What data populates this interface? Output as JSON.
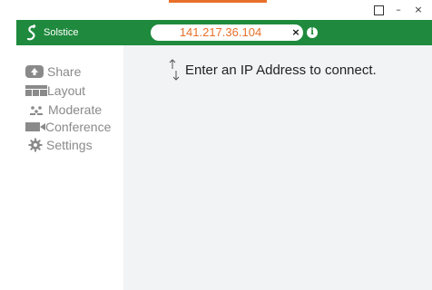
{
  "window": {
    "maximize_glyph": "",
    "minimize_glyph": "–",
    "close_glyph": "×"
  },
  "header": {
    "brand_name": "Solstice",
    "brand_icon": "solstice-logo-icon",
    "ip_value": "141.217.36.104",
    "clear_glyph": "×",
    "info_glyph": "i"
  },
  "sidebar": {
    "items": [
      {
        "label": "Share",
        "icon": "share-icon"
      },
      {
        "label": "Layout",
        "icon": "layout-icon"
      },
      {
        "label": "Moderate",
        "icon": "moderate-icon"
      },
      {
        "label": "Conference",
        "icon": "conference-icon"
      },
      {
        "label": "Settings",
        "icon": "gear-icon"
      }
    ]
  },
  "main": {
    "hint": "Enter an IP Address to connect."
  },
  "colors": {
    "header_bg": "#1f8a3d",
    "accent_orange": "#e8702a",
    "main_bg": "#f2f3f5",
    "nav_text": "#8a8a8a"
  }
}
